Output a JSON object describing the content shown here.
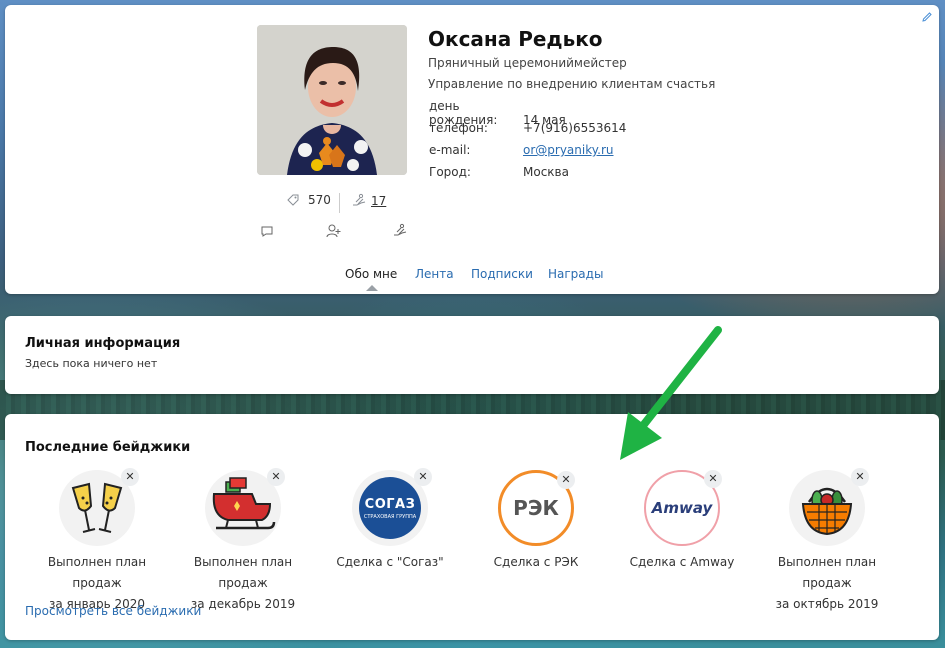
{
  "profile": {
    "name": "Оксана Редько",
    "position": "Пряничный церемониймейстер",
    "department": "Управление по внедрению клиентам счастья",
    "fields": [
      {
        "key": "день рождения:",
        "value": "14 мая"
      },
      {
        "key": "телефон:",
        "value": "+7(916)6553614"
      },
      {
        "key": "e-mail:",
        "value": "or@pryaniky.ru"
      },
      {
        "key": "Город:",
        "value": "Москва"
      }
    ],
    "stats": {
      "coins": "570",
      "thanks": "17"
    },
    "icons": {
      "coins": "tag-icon",
      "thanks": "hand-coin-icon",
      "message": "chat-icon",
      "subscribe": "add-user-icon",
      "give": "hand-give-icon",
      "edit": "pencil-icon"
    }
  },
  "tabs": [
    {
      "label": "Обо мне",
      "active": true
    },
    {
      "label": "Лента",
      "active": false
    },
    {
      "label": "Подписки",
      "active": false
    },
    {
      "label": "Награды",
      "active": false
    }
  ],
  "personal": {
    "title": "Личная информация",
    "text": "Здесь пока ничего нет"
  },
  "badges": {
    "title": "Последние бейджики",
    "items": [
      {
        "line1": "Выполнен план продаж",
        "line2": "за январь 2020",
        "icon": "champagne-icon"
      },
      {
        "line1": "Выполнен план продаж",
        "line2": "за декабрь 2019",
        "icon": "sleigh-icon"
      },
      {
        "line1": "Сделка с \"Согаз\"",
        "line2": "",
        "icon": "sogaz-logo",
        "logo_text": "СОГАЗ",
        "logo_sub": "СТРАХОВАЯ ГРУППА"
      },
      {
        "line1": "Сделка с РЭК",
        "line2": "",
        "icon": "rek-logo",
        "logo_text": "РЭК"
      },
      {
        "line1": "Сделка с Amway",
        "line2": "",
        "icon": "amway-logo",
        "logo_text": "Amway"
      },
      {
        "line1": "Выполнен план продаж",
        "line2": "за октябрь 2019",
        "icon": "vegetable-basket-icon"
      }
    ],
    "close_glyph": "✕",
    "view_all": "Просмотреть все бейджики"
  },
  "colors": {
    "link": "#2a6cb0",
    "arrow": "#1fb344"
  }
}
